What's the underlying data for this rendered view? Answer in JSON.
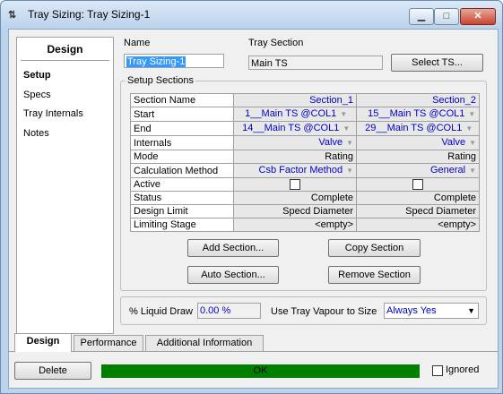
{
  "window": {
    "title": "Tray Sizing: Tray Sizing-1",
    "icon_glyph": "⇅"
  },
  "nav": {
    "header": "Design",
    "items": [
      "Setup",
      "Specs",
      "Tray Internals",
      "Notes"
    ]
  },
  "form": {
    "name_label": "Name",
    "name_value": "Tray Sizing-1",
    "tray_section_label": "Tray Section",
    "tray_section_value": "Main TS",
    "select_ts_button": "Select TS..."
  },
  "setup_sections": {
    "title": "Setup Sections",
    "columns": [
      "Section Name",
      "Section_1",
      "Section_2"
    ],
    "rows": [
      {
        "label": "Start",
        "v1": "1__Main TS @COL1",
        "v2": "15__Main TS @COL1"
      },
      {
        "label": "End",
        "v1": "14__Main TS @COL1",
        "v2": "29__Main TS @COL1"
      },
      {
        "label": "Internals",
        "v1": "Valve",
        "v2": "Valve"
      },
      {
        "label": "Mode",
        "v1": "Rating",
        "v2": "Rating"
      },
      {
        "label": "Calculation Method",
        "v1": "Csb Factor Method",
        "v2": "General"
      },
      {
        "label": "Active",
        "v1": "",
        "v2": ""
      },
      {
        "label": "Status",
        "v1": "Complete",
        "v2": "Complete"
      },
      {
        "label": "Design Limit",
        "v1": "Specd Diameter",
        "v2": "Specd Diameter"
      },
      {
        "label": "Limiting Stage",
        "v1": "<empty>",
        "v2": "<empty>"
      }
    ],
    "active_checked": [
      false,
      false
    ]
  },
  "actions": {
    "add_section": "Add Section...",
    "copy_section": "Copy Section",
    "auto_section": "Auto Section...",
    "remove_section": "Remove Section"
  },
  "liquid": {
    "label": "% Liquid Draw",
    "value": "0.00 %",
    "vapour_label": "Use Tray Vapour to Size",
    "vapour_value": "Always Yes"
  },
  "tabs": [
    "Design",
    "Performance",
    "Additional Information"
  ],
  "footer": {
    "delete_button": "Delete",
    "status": "OK",
    "ignored_label": "Ignored"
  },
  "colors": {
    "status_ok": "#008000",
    "selection": "#3399ff",
    "link_blue": "#0000d0"
  }
}
